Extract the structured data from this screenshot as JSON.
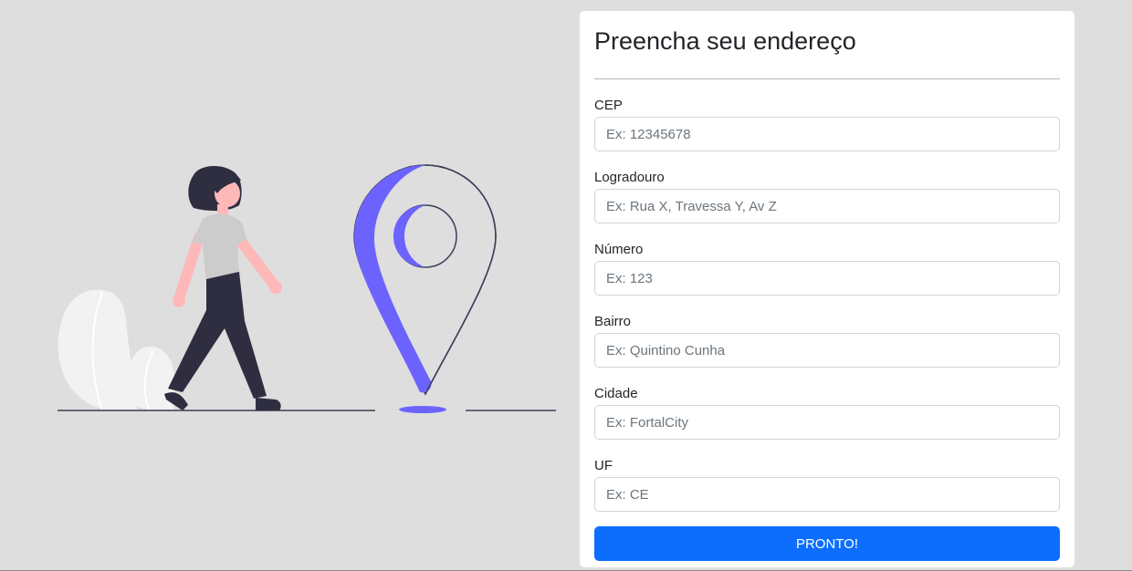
{
  "form": {
    "title": "Preencha seu endereço",
    "fields": [
      {
        "label": "CEP",
        "placeholder": "Ex: 12345678"
      },
      {
        "label": "Logradouro",
        "placeholder": "Ex: Rua X, Travessa Y, Av Z"
      },
      {
        "label": "Número",
        "placeholder": "Ex: 123"
      },
      {
        "label": "Bairro",
        "placeholder": "Ex: Quintino Cunha"
      },
      {
        "label": "Cidade",
        "placeholder": "Ex: FortalCity"
      },
      {
        "label": "UF",
        "placeholder": "Ex: CE"
      }
    ],
    "submit_label": "PRONTO!"
  },
  "illustration": {
    "subject": "woman walking toward map location pin",
    "icons": [
      "woman-figure",
      "map-pin-icon",
      "plant-leaf-icon"
    ]
  },
  "colors": {
    "background": "#dedede",
    "card": "#ffffff",
    "accent": "#6c63ff",
    "button": "#0d6efd",
    "figure_dark": "#2f2e41",
    "skin": "#ffb8b8",
    "shirt": "#cccccc",
    "leaf": "#f2f2f2"
  }
}
